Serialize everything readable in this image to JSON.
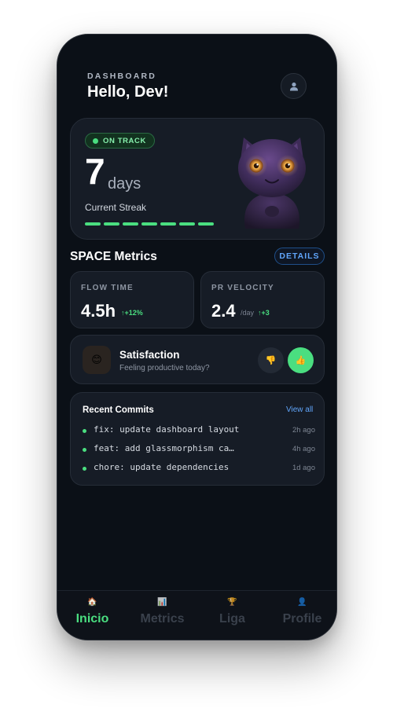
{
  "header": {
    "eyebrow": "DASHBOARD",
    "greeting": "Hello, Dev!",
    "avatar_icon": "user-icon"
  },
  "streak": {
    "badge": "ON TRACK",
    "value": "7",
    "unit": "days",
    "label": "Current Streak",
    "segments": 7,
    "mascot": "cat-mascot"
  },
  "space_metrics": {
    "title": "SPACE Metrics",
    "details_label": "DETAILS",
    "flow_time": {
      "label": "FLOW TIME",
      "value": "4.5h",
      "delta": "↑+12%"
    },
    "pr_velocity": {
      "label": "PR VELOCITY",
      "value": "2.4",
      "unit": "/day",
      "delta": "↑+3"
    }
  },
  "satisfaction": {
    "icon": "😊",
    "title": "Satisfaction",
    "subtitle": "Feeling productive today?",
    "thumbs_down": "👎",
    "thumbs_up": "👍"
  },
  "commits": {
    "title": "Recent Commits",
    "view_all": "View all",
    "items": [
      {
        "message": "fix: update dashboard layout",
        "time": "2h ago"
      },
      {
        "message": "feat: add glassmorphism ca…",
        "time": "4h ago"
      },
      {
        "message": "chore: update dependencies",
        "time": "1d ago"
      }
    ]
  },
  "nav": {
    "items": [
      {
        "icon": "🏠",
        "label": "Inicio",
        "active": true
      },
      {
        "icon": "📊",
        "label": "Metrics",
        "active": false
      },
      {
        "icon": "🏆",
        "label": "Liga",
        "active": false
      },
      {
        "icon": "👤",
        "label": "Profile",
        "active": false
      }
    ]
  },
  "colors": {
    "accent_green": "#4ade80",
    "accent_blue": "#60a5fa",
    "background": "#0b1017",
    "card": "#161c26"
  }
}
